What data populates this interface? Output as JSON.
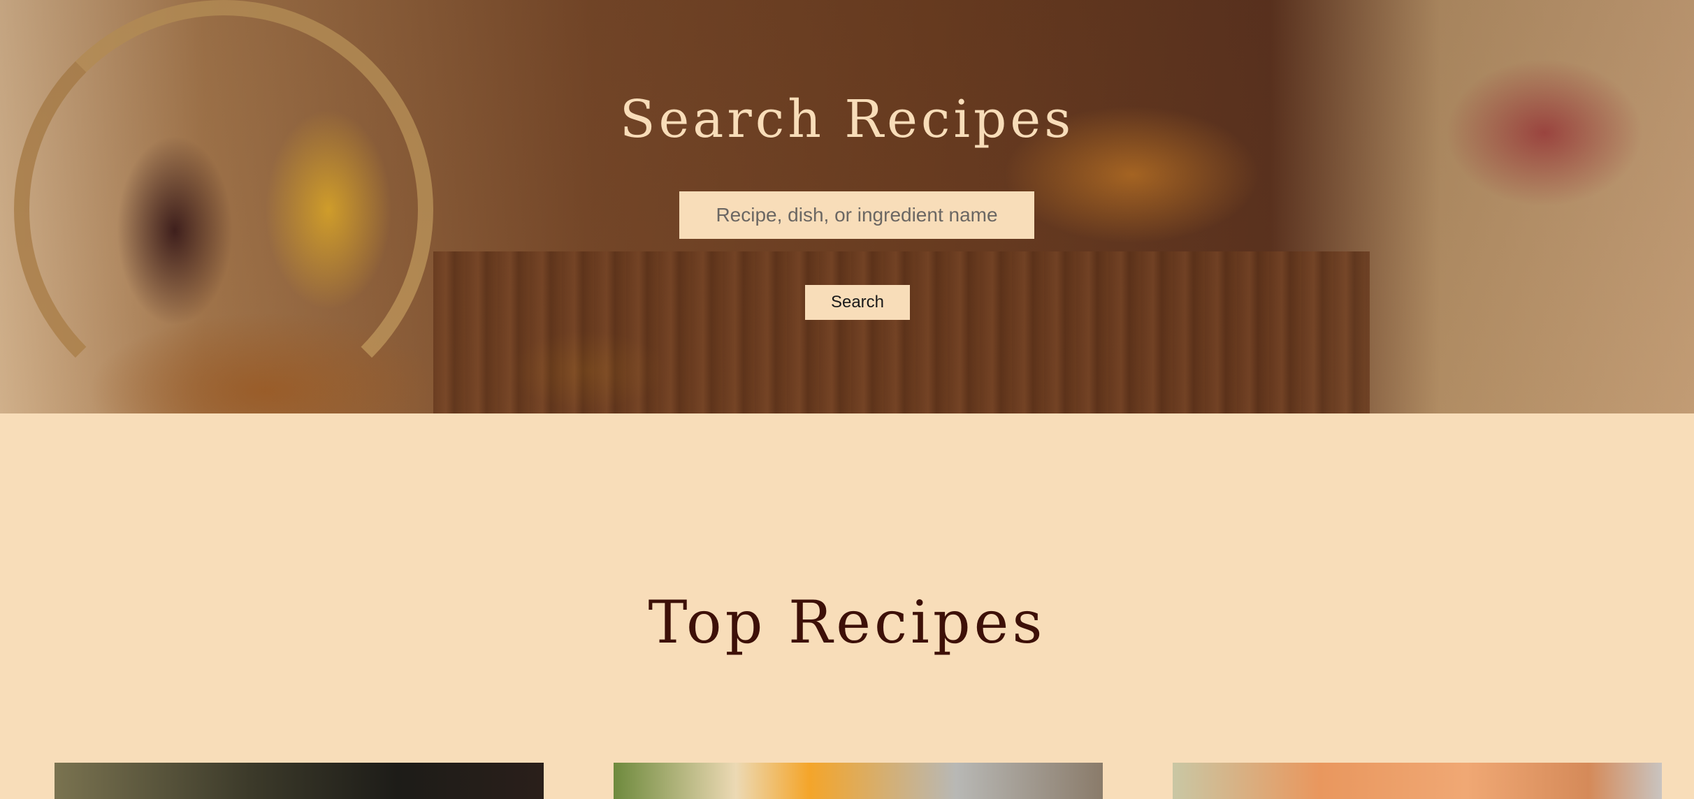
{
  "hero": {
    "title": "Search Recipes",
    "search_placeholder": "Recipe, dish, or ingredient name",
    "search_button_label": "Search"
  },
  "top_recipes": {
    "title": "Top Recipes",
    "cards": [
      {
        "image": "recipe-photo"
      },
      {
        "image": "recipe-photo"
      },
      {
        "image": "recipe-photo"
      }
    ]
  },
  "colors": {
    "background": "#f8ddb9",
    "heading_dark": "#3d1008",
    "hero_title": "#f8ddb9"
  }
}
